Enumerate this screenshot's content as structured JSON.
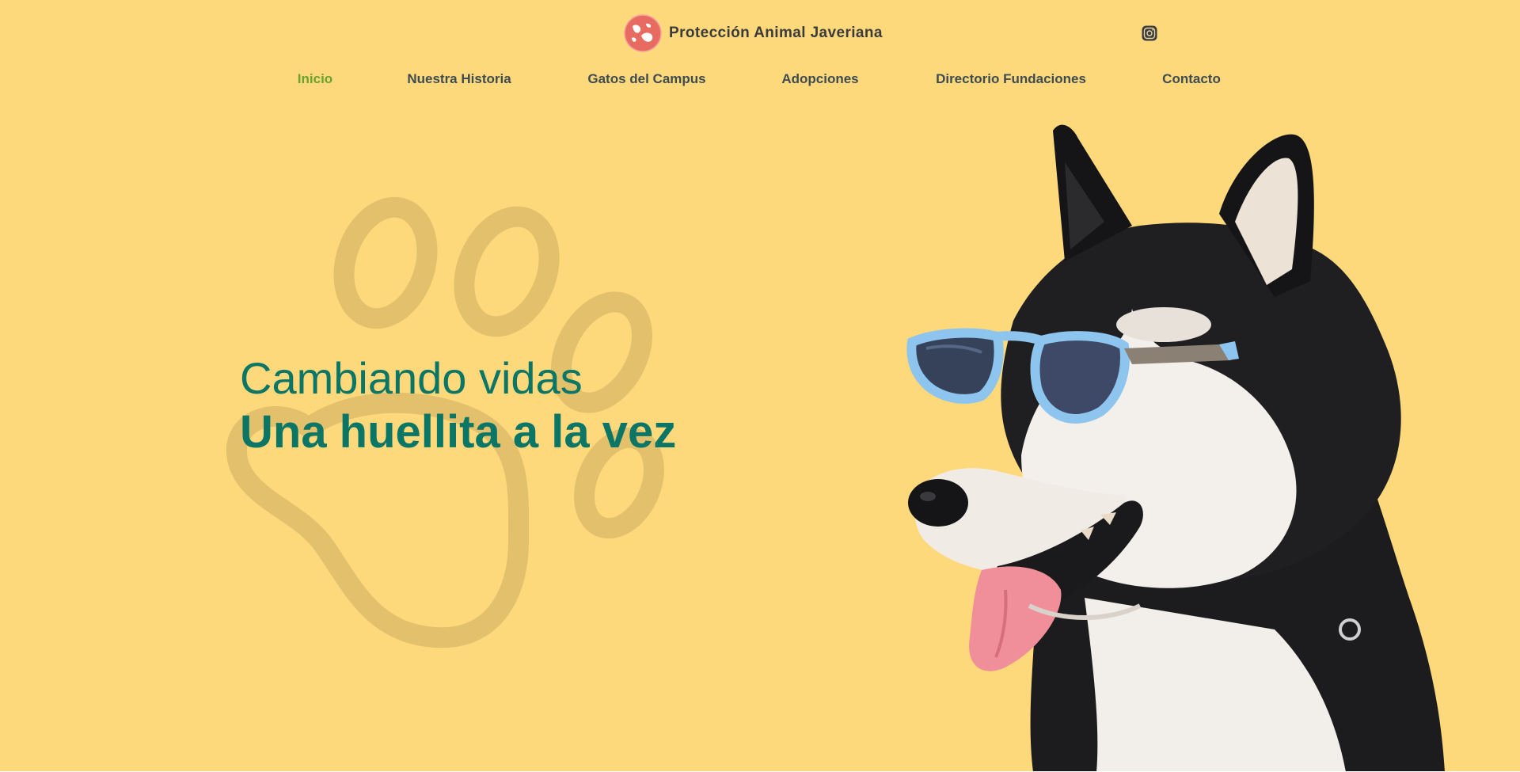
{
  "header": {
    "brand_name": "Protección Animal Javeriana",
    "logo_icon": "paw-logo-icon",
    "social_icon": "instagram-icon"
  },
  "nav": {
    "items": [
      {
        "label": "Inicio",
        "active": true
      },
      {
        "label": "Nuestra Historia",
        "active": false
      },
      {
        "label": "Gatos del Campus",
        "active": false
      },
      {
        "label": "Adopciones",
        "active": false
      },
      {
        "label": "Directorio Fundaciones",
        "active": false
      },
      {
        "label": "Contacto",
        "active": false
      }
    ]
  },
  "hero": {
    "line1": "Cambiando vidas",
    "line2": "Una huellita a la vez",
    "decoration_icon": "paw-outline-icon",
    "image": "husky-with-sunglasses"
  },
  "colors": {
    "background": "#fed97c",
    "heading": "#0b7666",
    "nav_text": "#3e4b4f",
    "nav_active": "#6aa22f",
    "logo": "#e86b62",
    "paw_outline": "#e3c16c"
  }
}
